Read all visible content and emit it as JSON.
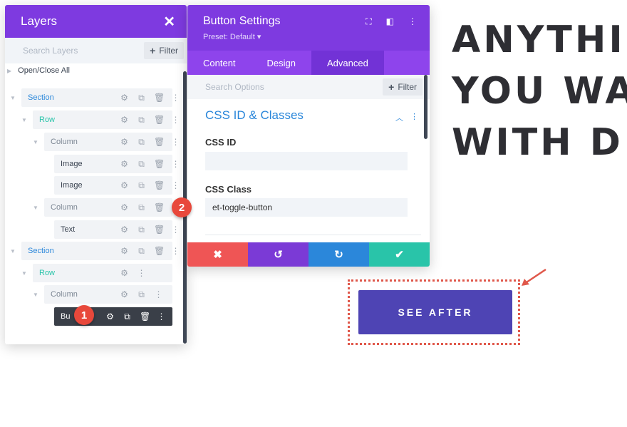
{
  "hero": {
    "line1": "ANYTHI",
    "line2": "YOU WA",
    "line3": "WITH D"
  },
  "page_button": {
    "label": "SEE AFTER"
  },
  "layers": {
    "title": "Layers",
    "search_placeholder": "Search Layers",
    "filter_label": "Filter",
    "open_close": "Open/Close All",
    "items": [
      {
        "label": "Section",
        "type": "section"
      },
      {
        "label": "Row",
        "type": "row"
      },
      {
        "label": "Column",
        "type": "column"
      },
      {
        "label": "Image",
        "type": "module"
      },
      {
        "label": "Image",
        "type": "module"
      },
      {
        "label": "Column",
        "type": "column"
      },
      {
        "label": "Text",
        "type": "module"
      },
      {
        "label": "Section",
        "type": "section"
      },
      {
        "label": "Row",
        "type": "row"
      },
      {
        "label": "Column",
        "type": "column"
      },
      {
        "label": "Bu",
        "type": "module-active"
      }
    ]
  },
  "settings": {
    "title": "Button Settings",
    "preset": "Preset: Default ▾",
    "tabs": [
      "Content",
      "Design",
      "Advanced"
    ],
    "active_tab": "Advanced",
    "search_placeholder": "Search Options",
    "filter_label": "Filter",
    "section_title": "CSS ID & Classes",
    "css_id_label": "CSS ID",
    "css_id_value": "",
    "css_class_label": "CSS Class",
    "css_class_value": "et-toggle-button"
  },
  "badges": {
    "one": "1",
    "two": "2"
  },
  "colors": {
    "purple": "#7e3ae0",
    "tab_purple": "#8e44ec",
    "blue": "#2b87da",
    "teal": "#29c4a9",
    "red": "#ef5555",
    "action_purple": "#7b3ad6",
    "action_blue": "#2b87da",
    "action_green": "#29c4a9",
    "page_button": "#4e44b4"
  }
}
